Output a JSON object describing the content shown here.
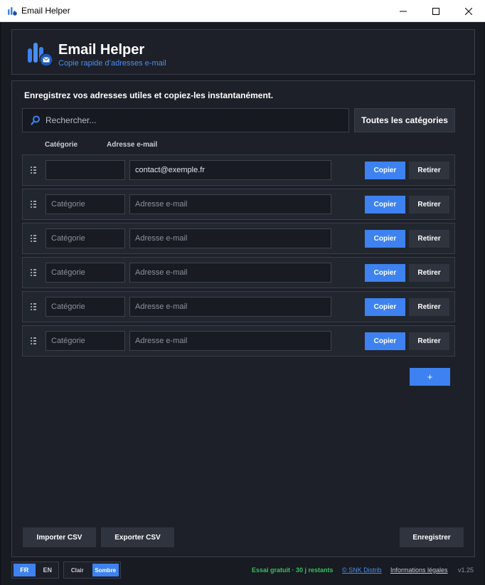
{
  "window": {
    "title": "Email Helper"
  },
  "header": {
    "app_name": "Email Helper",
    "subtitle": "Copie rapide d’adresses e-mail"
  },
  "main": {
    "intro": "Enregistrez vos adresses utiles et copiez-les instantanément.",
    "search_placeholder": "Rechercher...",
    "category_filter": "Toutes les catégories",
    "columns": {
      "category": "Catégorie",
      "email": "Adresse e-mail"
    },
    "rows": [
      {
        "category": "",
        "email": "contact@exemple.fr",
        "category_placeholder": "",
        "email_placeholder": "Adresse e-mail"
      },
      {
        "category": "",
        "email": "",
        "category_placeholder": "Catégorie",
        "email_placeholder": "Adresse e-mail"
      },
      {
        "category": "",
        "email": "",
        "category_placeholder": "Catégorie",
        "email_placeholder": "Adresse e-mail"
      },
      {
        "category": "",
        "email": "",
        "category_placeholder": "Catégorie",
        "email_placeholder": "Adresse e-mail"
      },
      {
        "category": "",
        "email": "",
        "category_placeholder": "Catégorie",
        "email_placeholder": "Adresse e-mail"
      },
      {
        "category": "",
        "email": "",
        "category_placeholder": "Catégorie",
        "email_placeholder": "Adresse e-mail"
      }
    ],
    "copy_label": "Copier",
    "remove_label": "Retirer",
    "add_label": "+",
    "import_label": "Importer CSV",
    "export_label": "Exporter CSV",
    "save_label": "Enregistrer"
  },
  "footer": {
    "lang_fr": "FR",
    "lang_en": "EN",
    "active_lang": "FR",
    "theme_light": "Clair",
    "theme_dark": "Sombre",
    "active_theme": "Sombre",
    "trial": "Essai gratuit · 30 j restants",
    "link_snk": "© SNK Distrib",
    "link_legal": "Informations légales",
    "version": "v1.25"
  },
  "colors": {
    "accent": "#3d82f0",
    "trial": "#3bbf5e",
    "background": "#181b22"
  }
}
